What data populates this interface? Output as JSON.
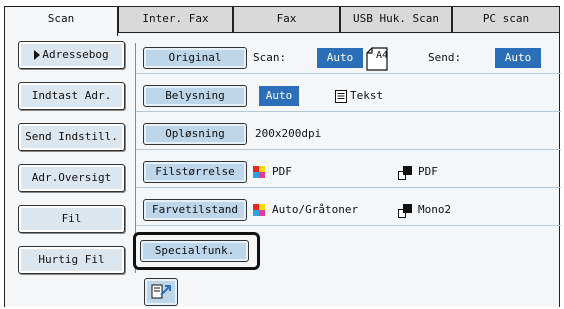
{
  "tabs": [
    {
      "label": "Scan",
      "active": true
    },
    {
      "label": "Inter. Fax",
      "active": false
    },
    {
      "label": "Fax",
      "active": false
    },
    {
      "label": "USB Huk. Scan",
      "active": false
    },
    {
      "label": "PC scan",
      "active": false
    }
  ],
  "sidebar": {
    "items": [
      {
        "label": "Adressebog",
        "icon": "triangle-right-icon"
      },
      {
        "label": "Indtast Adr."
      },
      {
        "label": "Send Indstill."
      },
      {
        "label": "Adr.Oversigt"
      },
      {
        "label": "Fil"
      },
      {
        "label": "Hurtig Fil"
      }
    ]
  },
  "settings": {
    "original": {
      "button": "Original",
      "scan_label": "Scan:",
      "scan_value": "Auto",
      "paper_size": "A4",
      "send_label": "Send:",
      "send_value": "Auto"
    },
    "exposure": {
      "button": "Belysning",
      "value": "Auto",
      "mode": "Tekst"
    },
    "resolution": {
      "button": "Opløsning",
      "value": "200x200dpi"
    },
    "file_format": {
      "button": "Filstørrelse",
      "color_value": "PDF",
      "mono_value": "PDF"
    },
    "color_mode": {
      "button": "Farvetilstand",
      "color_value": "Auto/Gråtoner",
      "mono_value": "Mono2"
    }
  },
  "special": {
    "label": "Specialfunk."
  },
  "colors": {
    "accent": "#2a6fb8",
    "button_bg": "#bdd6ea",
    "panel_bg": "#f4f6f8"
  }
}
